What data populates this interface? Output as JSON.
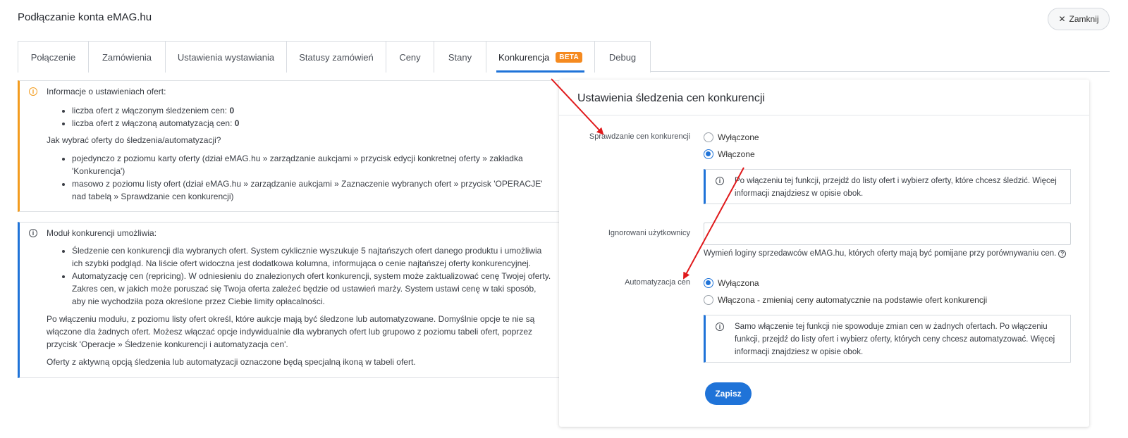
{
  "header": {
    "title": "Podłączanie konta eMAG.hu",
    "close_label": "Zamknij"
  },
  "tabs": [
    {
      "label": "Połączenie"
    },
    {
      "label": "Zamówienia"
    },
    {
      "label": "Ustawienia wystawiania"
    },
    {
      "label": "Statusy zamówień"
    },
    {
      "label": "Ceny"
    },
    {
      "label": "Stany"
    },
    {
      "label": "Konkurencja",
      "badge": "BETA",
      "active": true
    },
    {
      "label": "Debug"
    }
  ],
  "info_offers": {
    "heading": "Informacje o ustawieniach ofert:",
    "stats": [
      {
        "label": "liczba ofert z włączonym śledzeniem cen: ",
        "value": "0"
      },
      {
        "label": "liczba ofert z włączoną automatyzacją cen: ",
        "value": "0"
      }
    ],
    "question": "Jak wybrać oferty do śledzenia/automatyzacji?",
    "methods": [
      "pojedynczo z poziomu karty oferty (dział eMAG.hu » zarządzanie aukcjami » przycisk edycji konkretnej oferty » zakładka 'Konkurencja')",
      "masowo z poziomu listy ofert (dział eMAG.hu » zarządzanie aukcjami » Zaznaczenie wybranych ofert » przycisk 'OPERACJE' nad tabelą » Sprawdzanie cen konkurencji)"
    ]
  },
  "info_module": {
    "heading": "Moduł konkurencji umożliwia:",
    "features": [
      "Śledzenie cen konkurencji dla wybranych ofert. System cyklicznie wyszukuje 5 najtańszych ofert danego produktu i umożliwia ich szybki podgląd. Na liście ofert widoczna jest dodatkowa kolumna, informująca o cenie najtańszej oferty konkurencyjnej.",
      "Automatyzację cen (repricing). W odniesieniu do znalezionych ofert konkurencji, system może zaktualizować cenę Twojej oferty. Zakres cen, w jakich może poruszać się Twoja oferta zależeć będzie od ustawień marży. System ustawi cenę w taki sposób, aby nie wychodziła poza określone przez Ciebie limity opłacalności."
    ],
    "paragraph1": "Po włączeniu modułu, z poziomu listy ofert określ, które aukcje mają być śledzone lub automatyzowane. Domyślnie opcje te nie są włączone dla żadnych ofert. Możesz włączać opcje indywidualnie dla wybranych ofert lub grupowo z poziomu tabeli ofert, poprzez przycisk 'Operacje » Śledzenie konkurencji i automatyzacja cen'.",
    "paragraph2": "Oferty z aktywną opcją śledzenia lub automatyzacji oznaczone będą specjalną ikoną w tabeli ofert."
  },
  "settings": {
    "title": "Ustawienia śledzenia cen konkurencji",
    "price_check": {
      "label": "Sprawdzanie cen konkurencji",
      "options": [
        "Wyłączone",
        "Włączone"
      ],
      "selected": "Włączone",
      "note": "Po włączeniu tej funkcji, przejdź do listy ofert i wybierz oferty, które chcesz śledzić. Więcej informacji znajdziesz w opisie obok."
    },
    "ignored_users": {
      "label": "Ignorowani użytkownicy",
      "value": "",
      "hint": "Wymień loginy sprzedawców eMAG.hu, których oferty mają być pomijane przy porównywaniu cen."
    },
    "automation": {
      "label": "Automatyzacja cen",
      "options": [
        "Wyłączona",
        "Włączona - zmieniaj ceny automatycznie na podstawie ofert konkurencji"
      ],
      "selected": "Wyłączona",
      "note": "Samo włączenie tej funkcji nie spowoduje zmian cen w żadnych ofertach. Po włączeniu funkcji, przejdź do listy ofert i wybierz oferty, których ceny chcesz automatyzować. Więcej informacji znajdziesz w opisie obok."
    },
    "save_label": "Zapisz"
  },
  "colors": {
    "primary": "#1f73d8",
    "beta_badge": "#f58a1f",
    "warning_border": "#f39c1f",
    "annotation_arrow": "#e0191b"
  }
}
